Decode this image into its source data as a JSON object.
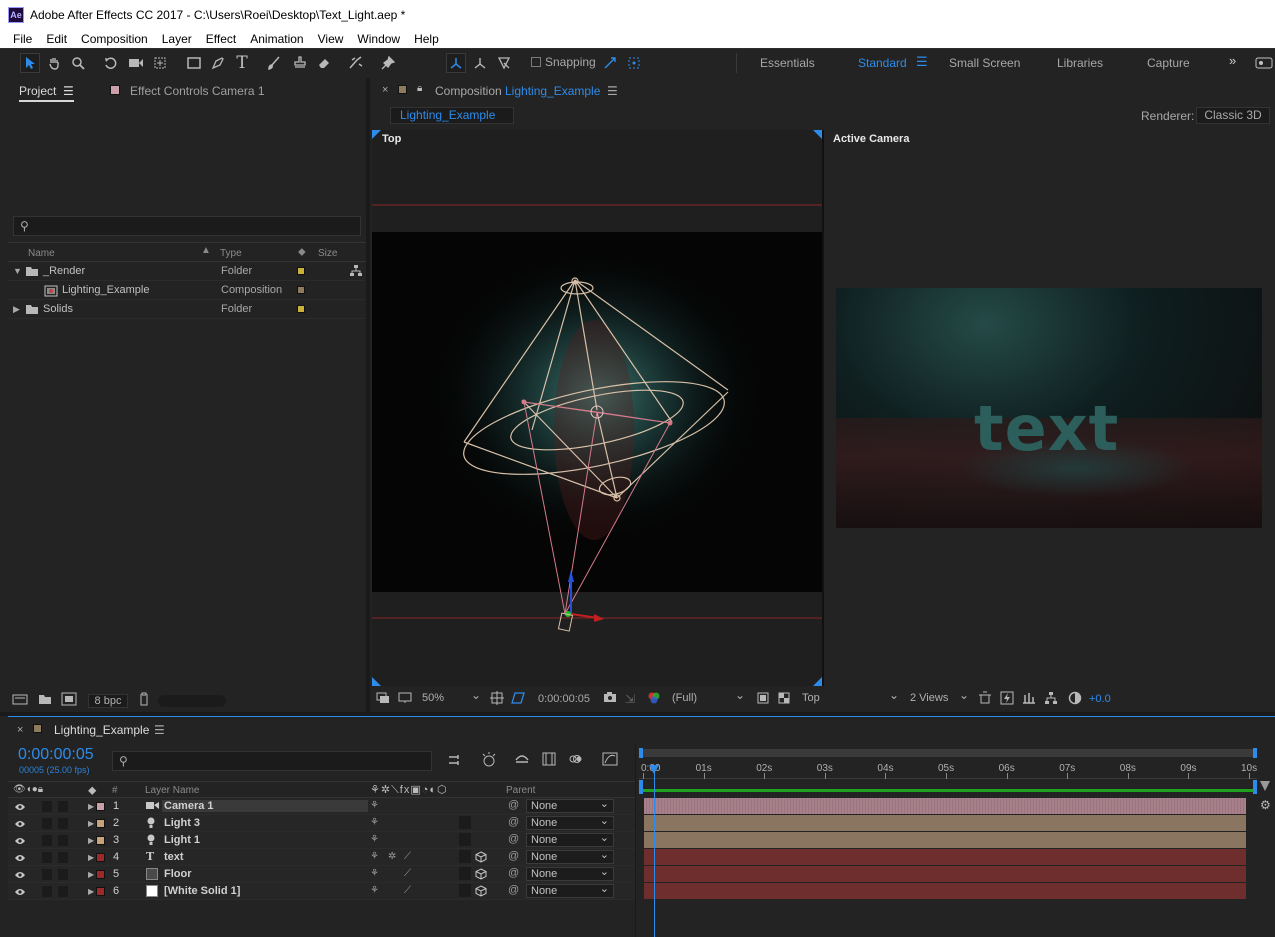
{
  "window": {
    "title": "Adobe After Effects CC 2017 - C:\\Users\\Roei\\Desktop\\Text_Light.aep *",
    "app_icon": "Ae"
  },
  "menu": [
    "File",
    "Edit",
    "Composition",
    "Layer",
    "Effect",
    "Animation",
    "View",
    "Window",
    "Help"
  ],
  "toolbar": {
    "snapping_label": "Snapping",
    "workspaces": [
      "Essentials",
      "Standard",
      "Small Screen",
      "Libraries",
      "Capture"
    ],
    "active_workspace": "Standard"
  },
  "project": {
    "tab": "Project",
    "effect_tab": "Effect Controls Camera 1",
    "search_placeholder": "",
    "columns": {
      "name": "Name",
      "type": "Type",
      "size": "Size"
    },
    "items": [
      {
        "name": "_Render",
        "type": "Folder",
        "color": "#c9b23a",
        "expanded": true,
        "kind": "folder",
        "indent": 0
      },
      {
        "name": "Lighting_Example",
        "type": "Composition",
        "color": "#8e7a5e",
        "kind": "comp",
        "indent": 1
      },
      {
        "name": "Solids",
        "type": "Folder",
        "color": "#c9b23a",
        "expanded": false,
        "kind": "folder",
        "indent": 0
      }
    ],
    "bpc": "8 bpc"
  },
  "composition": {
    "panel_label": "Composition",
    "name": "Lighting_Example",
    "flow_tab": "Lighting_Example",
    "renderer_label": "Renderer:",
    "renderer": "Classic 3D",
    "view_left": "Top",
    "view_right": "Active Camera",
    "render_text": "text"
  },
  "viewer_bar": {
    "zoom": "50%",
    "timecode": "0:00:00:05",
    "resolution": "(Full)",
    "view": "Top",
    "views": "2 Views",
    "exposure": "+0.0"
  },
  "timeline": {
    "tab": "Lighting_Example",
    "timecode": "0:00:00:05",
    "frame_info": "00005 (25.00 fps)",
    "search_placeholder": "",
    "col_hash": "#",
    "col_layer_name": "Layer Name",
    "col_parent": "Parent",
    "ruler": [
      "0:00",
      "01s",
      "02s",
      "03s",
      "04s",
      "05s",
      "06s",
      "07s",
      "08s",
      "09s",
      "10s"
    ],
    "playhead_fraction": 0.02,
    "layers": [
      {
        "num": "1",
        "name": "Camera 1",
        "icon": "camera-icon",
        "label": "#c9a0a8",
        "parent": "None",
        "bar": "#a8808a",
        "selected": true
      },
      {
        "num": "2",
        "name": "Light 3",
        "icon": "light-icon",
        "label": "#c8a27a",
        "parent": "None",
        "bar": "#8a7560"
      },
      {
        "num": "3",
        "name": "Light 1",
        "icon": "light-icon",
        "label": "#c8a27a",
        "parent": "None",
        "bar": "#8a7560"
      },
      {
        "num": "4",
        "name": "text",
        "icon": "text-layer-icon",
        "label": "#9c2a2a",
        "parent": "None",
        "bar": "#6e2e2e"
      },
      {
        "num": "5",
        "name": "Floor",
        "icon": "solid-icon",
        "label": "#9c2a2a",
        "parent": "None",
        "bar": "#6e2e2e"
      },
      {
        "num": "6",
        "name": "[White Solid 1]",
        "icon": "solid-icon",
        "label": "#9c2a2a",
        "parent": "None",
        "bar": "#6e2e2e"
      }
    ]
  }
}
